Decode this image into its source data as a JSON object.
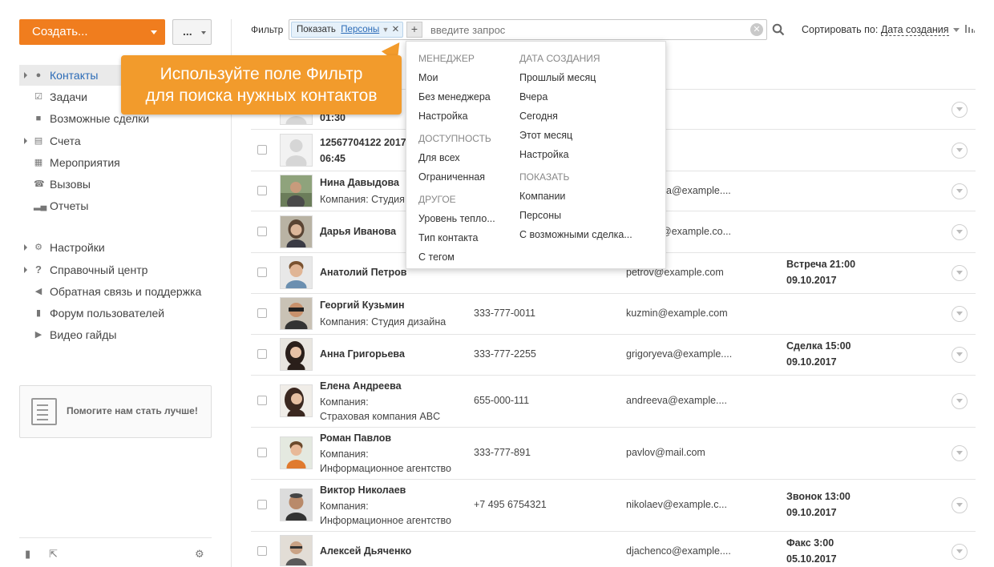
{
  "toolbar": {
    "create_label": "Создать...",
    "more_label": "..."
  },
  "sidebar": {
    "items": [
      {
        "label": "Контакты",
        "icon": "person-icon"
      },
      {
        "label": "Задачи",
        "icon": "checkbox-icon"
      },
      {
        "label": "Возможные сделки",
        "icon": "briefcase-icon"
      },
      {
        "label": "Счета",
        "icon": "document-icon"
      },
      {
        "label": "Мероприятия",
        "icon": "calendar-icon"
      },
      {
        "label": "Вызовы",
        "icon": "phone-icon"
      },
      {
        "label": "Отчеты",
        "icon": "bar-chart-icon"
      }
    ],
    "support_items": [
      {
        "label": "Настройки",
        "icon": "gear-icon"
      },
      {
        "label": "Справочный центр",
        "icon": "question-icon"
      },
      {
        "label": "Обратная связь и поддержка",
        "icon": "megaphone-icon"
      },
      {
        "label": "Форум пользователей",
        "icon": "chat-icon"
      },
      {
        "label": "Видео гайды",
        "icon": "play-icon"
      }
    ],
    "help_label": "Помогите нам стать лучше!"
  },
  "filter": {
    "label": "Фильтр",
    "tag_prefix": "Показать",
    "tag_value": "Персоны",
    "add": "+",
    "placeholder": "введите запрос",
    "sort_label": "Сортировать по:",
    "sort_value": "Дата создания"
  },
  "callout": {
    "line1": "Используйте поле Фильтр",
    "line2": "для поиска нужных контактов"
  },
  "dropdown": {
    "left": [
      {
        "type": "h",
        "text": "МЕНЕДЖЕР"
      },
      {
        "type": "i",
        "text": "Мои"
      },
      {
        "type": "i",
        "text": "Без менеджера"
      },
      {
        "type": "i",
        "text": "Настройка"
      },
      {
        "type": "h",
        "text": "ДОСТУПНОСТЬ"
      },
      {
        "type": "i",
        "text": "Для всех"
      },
      {
        "type": "i",
        "text": "Ограниченная"
      },
      {
        "type": "h",
        "text": "ДРУГОЕ"
      },
      {
        "type": "i",
        "text": "Уровень тепло..."
      },
      {
        "type": "i",
        "text": "Тип контакта"
      },
      {
        "type": "i",
        "text": "С тегом"
      }
    ],
    "right": [
      {
        "type": "h",
        "text": "ДАТА СОЗДАНИЯ"
      },
      {
        "type": "i",
        "text": "Прошлый месяц"
      },
      {
        "type": "i",
        "text": "Вчера"
      },
      {
        "type": "i",
        "text": "Сегодня"
      },
      {
        "type": "i",
        "text": "Этот месяц"
      },
      {
        "type": "i",
        "text": "Настройка"
      },
      {
        "type": "h",
        "text": "ПОКАЗАТЬ"
      },
      {
        "type": "i",
        "text": "Компании"
      },
      {
        "type": "i",
        "text": "Персоны"
      },
      {
        "type": "i",
        "text": "С возможными сделка..."
      }
    ]
  },
  "contacts": [
    {
      "name": "01:30",
      "company": "",
      "company2": "",
      "phone": "",
      "email": "",
      "event1": "",
      "event2": ""
    },
    {
      "name": "12567704122 2017",
      "company": "06:45",
      "company2": "",
      "phone": "",
      "email": "",
      "event1": "",
      "event2": ""
    },
    {
      "name": "Нина Давыдова",
      "company": "Компания: Студия",
      "company2": "",
      "phone": "",
      "email": "a@example....",
      "event1": "",
      "event2": ""
    },
    {
      "name": "Дарья Иванова",
      "company": "",
      "company2": "",
      "phone": "",
      "email": "@example.co...",
      "event1": "",
      "event2": ""
    },
    {
      "name": "Анатолий Петров",
      "company": "",
      "company2": "",
      "phone": "",
      "email": "petrov@example.com",
      "event1": "Встреча 21:00",
      "event2": "09.10.2017"
    },
    {
      "name": "Георгий Кузьмин",
      "company": "Компания: Студия дизайна",
      "company2": "",
      "phone": "333-777-0011",
      "email": "kuzmin@example.com",
      "event1": "",
      "event2": ""
    },
    {
      "name": "Анна Григорьева",
      "company": "",
      "company2": "",
      "phone": "333-777-2255",
      "email": "grigoryeva@example....",
      "event1": "Сделка 15:00",
      "event2": "09.10.2017"
    },
    {
      "name": "Елена Андреева",
      "company": "Компания:",
      "company2": "Страховая компания ABC",
      "phone": "655-000-111",
      "email": "andreeva@example....",
      "event1": "",
      "event2": ""
    },
    {
      "name": "Роман Павлов",
      "company": "Компания:",
      "company2": "Информационное агентство",
      "phone": "333-777-891",
      "email": "pavlov@mail.com",
      "event1": "",
      "event2": ""
    },
    {
      "name": "Виктор Николаев",
      "company": "Компания:",
      "company2": "Информационное агентство",
      "phone": "+7 495 6754321",
      "email": "nikolaev@example.c...",
      "event1": "Звонок 13:00",
      "event2": "09.10.2017"
    },
    {
      "name": "Алексей Дьяченко",
      "company": "",
      "company2": "",
      "phone": "",
      "email": "djachenco@example....",
      "event1": "Факс 3:00",
      "event2": "05.10.2017"
    }
  ]
}
